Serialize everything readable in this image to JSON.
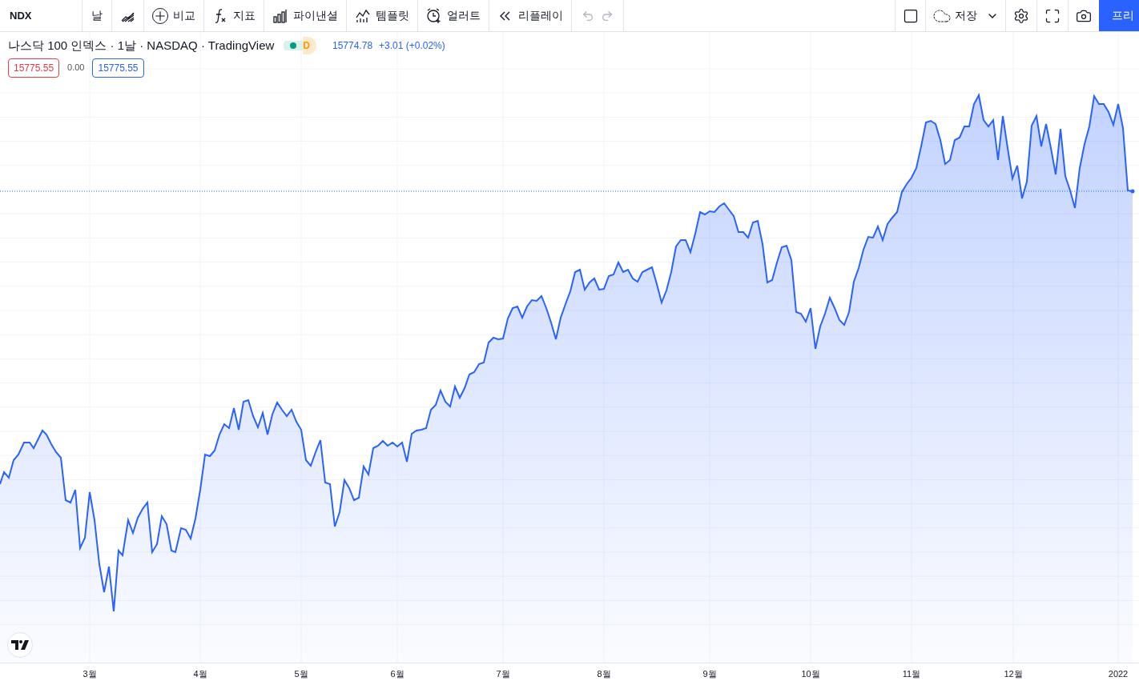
{
  "toolbar": {
    "symbol": "NDX",
    "interval": "날",
    "left_buttons": [
      {
        "label": "비교"
      },
      {
        "label": "지표"
      },
      {
        "label": "파이낸셜"
      },
      {
        "label": "템플릿"
      },
      {
        "label": "얼러트"
      },
      {
        "label": "리플레이"
      }
    ],
    "history": [
      {
        "kind": "undo",
        "disabled": true
      },
      {
        "kind": "redo",
        "disabled": true
      }
    ],
    "save": {
      "label": "저장"
    },
    "publish": {
      "label": "프리"
    }
  },
  "legend": {
    "title": "나스닥 100 인덱스 · 1날 · NASDAQ · TradingView",
    "timeframe_badge": "D",
    "price": "15774.78",
    "change": "+3.01 (+0.02%)",
    "values": [
      {
        "text": "15775.55",
        "color": "#f23645"
      },
      {
        "text": "0.00"
      },
      {
        "text": "15775.55",
        "color": "#2962ff"
      }
    ]
  },
  "x_axis": {
    "labels": [
      "3월",
      "4월",
      "5월",
      "6월",
      "7월",
      "8월",
      "9월",
      "10월",
      "11월",
      "12월",
      "2022"
    ]
  }
}
